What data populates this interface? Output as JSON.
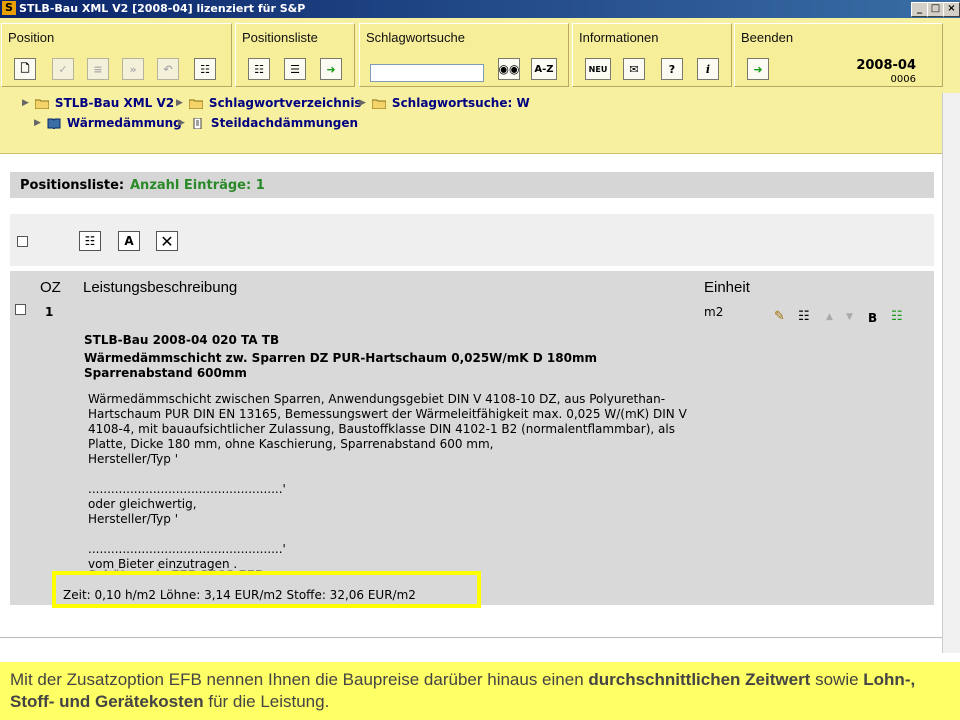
{
  "window": {
    "title": "STLB-Bau XML V2 [2008-04] lizenziert für S&P",
    "app_icon": "S"
  },
  "toolbar": {
    "groups": [
      {
        "label": "Position"
      },
      {
        "label": "Positionsliste"
      },
      {
        "label": "Schlagwortsuche"
      },
      {
        "label": "Informationen"
      },
      {
        "label": "Beenden"
      }
    ],
    "az_label": "A-Z",
    "neu_label": "NEU",
    "search_value": "",
    "version": "2008-04",
    "build": "0006"
  },
  "breadcrumb": {
    "items": [
      "STLB-Bau XML V2",
      "Schlagwortverzeichnis",
      "Schlagwortsuche: W",
      "Wärmedämmung",
      "Steildachdämmungen"
    ]
  },
  "panel": {
    "title": "Positionsliste:",
    "count": "Anzahl Einträge: 1"
  },
  "table": {
    "headers": {
      "oz": "OZ",
      "desc": "Leistungsbeschreibung",
      "unit": "Einheit"
    },
    "row": {
      "oz": "1",
      "unit": "m2",
      "b_label": "B",
      "code": "STLB-Bau 2008-04 020 TA TB",
      "short_text": "Wärmedämmschicht zw. Sparren DZ PUR-Hartschaum 0,025W/mK D 180mm Sparrenabstand 600mm",
      "long_text": "Wärmedämmschicht zwischen Sparren, Anwendungsgebiet DIN V 4108-10 DZ, aus Polyurethan-\nHartschaum PUR DIN EN 13165, Bemessungswert der Wärmeleitfähigkeit max. 0,025 W/(mK) DIN V\n4108-4, mit bauaufsichtlicher Zulassung, Baustoffklasse DIN 4102-1 B2 (normalentflammbar), als\nPlatte, Dicke 180 mm, ohne Kaschierung, Sparrenabstand 600 mm,\nHersteller/Typ '\n\n...................................................'\noder gleichwertig,\nHersteller/Typ '\n\n...................................................'\nvom Bieter einzutragen .",
      "partial_line": "Schätzpreis EFB 2008 EFB",
      "efb": "Zeit: 0,10 h/m2   Löhne: 3,14 EUR/m2   Stoffe: 32,06 EUR/m2"
    }
  },
  "caption": {
    "part1": "Mit der Zusatzoption EFB nennen Ihnen die Baupreise darüber hinaus einen ",
    "bold1": "durchschnittlichen Zeitwert",
    "part2": " sowie ",
    "bold2": "Lohn-, Stoff- und Gerätekosten",
    "part3": " für die Leistung."
  }
}
